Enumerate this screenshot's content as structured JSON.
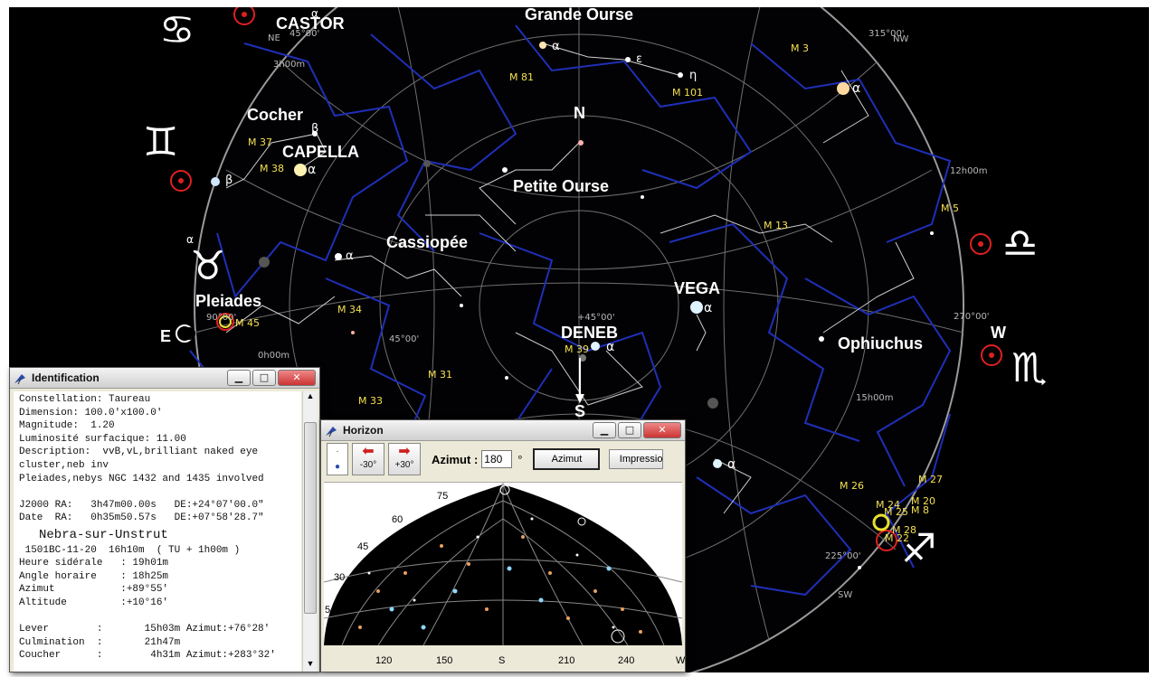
{
  "sky": {
    "constellation_labels": [
      {
        "id": "castor",
        "text": "CASTOR"
      },
      {
        "id": "grande-ourse",
        "text": "Grande Ourse"
      },
      {
        "id": "cocher",
        "text": "Cocher"
      },
      {
        "id": "capella",
        "text": "CAPELLA"
      },
      {
        "id": "n",
        "text": "N"
      },
      {
        "id": "petite-ourse",
        "text": "Petite Ourse"
      },
      {
        "id": "cassiopee",
        "text": "Cassiopée"
      },
      {
        "id": "pleiades",
        "text": "Pleiades"
      },
      {
        "id": "vega",
        "text": "VEGA"
      },
      {
        "id": "deneb",
        "text": "DENEB"
      },
      {
        "id": "ophiuchus",
        "text": "Ophiuchus"
      },
      {
        "id": "e",
        "text": "E"
      },
      {
        "id": "w",
        "text": "W"
      },
      {
        "id": "s",
        "text": "S"
      }
    ],
    "messier_labels": [
      "M 3",
      "M 81",
      "M 101",
      "M 37",
      "M 38",
      "M 13",
      "M 5",
      "M 45",
      "M 34",
      "M 39",
      "M 31",
      "M 33",
      "M 26",
      "M 27",
      "M 24",
      "M 25",
      "M 20",
      "M 8",
      "M 28",
      "M 22"
    ],
    "grid_labels": [
      "NE",
      "45°00'",
      "3h00m",
      "315°00'",
      "NW",
      "12h00m",
      "90°00'",
      "0h00m",
      "+45°00'",
      "45°00'",
      "270°00'",
      "15h00m",
      "225°00'",
      "SW"
    ],
    "greek_labels": [
      "α",
      "α",
      "ε",
      "η",
      "α",
      "β",
      "β",
      "α",
      "α",
      "α",
      "α",
      "α",
      "α"
    ]
  },
  "identification": {
    "title": "Identification",
    "lines": [
      "Constellation: Taureau",
      "Dimension: 100.0'x100.0'",
      "Magnitude:  1.20",
      "Luminosité surfacique: 11.00",
      "Description:  vvB,vL,brilliant naked eye",
      "cluster,neb inv",
      "Pleiades,nebys NGC 1432 and 1435 involved",
      "",
      "J2000 RA:   3h47m00.00s   DE:+24°07'00.0\"",
      "Date  RA:   0h35m50.57s   DE:+07°58'28.7\""
    ],
    "place": "Nebra-sur-Unstrut",
    "datetime": " 1501BC-11-20  16h10m  ( TU + 1h00m )",
    "lines2": [
      "Heure sidérale   : 19h01m",
      "Angle horaire    : 18h25m",
      "Azimut           :+89°55'",
      "Altitude         :+10°16'",
      "",
      "Lever        :       15h03m Azimut:+76°28'",
      "Culmination  :       21h47m",
      "Coucher      :        4h31m Azimut:+283°32'"
    ]
  },
  "horizon": {
    "title": "Horizon",
    "btn_minus": "-30°",
    "btn_plus": "+30°",
    "azimut_label": "Azimut :",
    "azimut_value": "180",
    "azimut_unit": "°",
    "azimut_button": "Azimut",
    "print_button": "Impressio",
    "alt_labels": [
      "75",
      "60",
      "45",
      "30",
      "5"
    ],
    "az_labels": [
      "120",
      "150",
      "S",
      "210",
      "240",
      "W"
    ]
  },
  "colors": {
    "sky": "#000000",
    "boundary": "#1f2fb8",
    "lines": "#c8c8c8",
    "messier": "#f5e050",
    "marker": "#e02020"
  }
}
